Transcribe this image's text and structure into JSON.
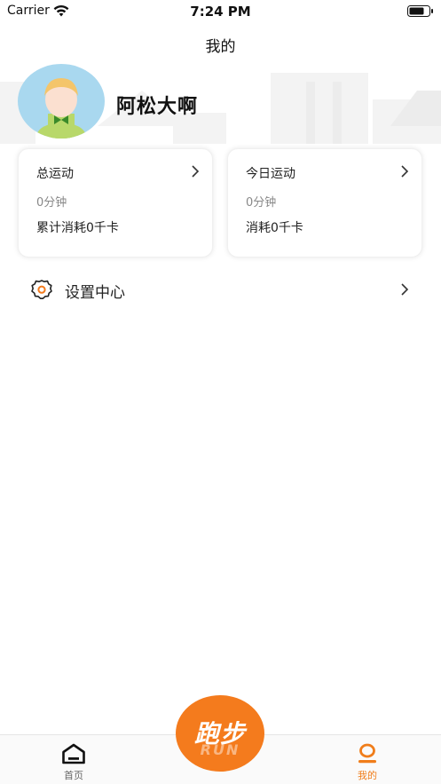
{
  "status_bar": {
    "carrier": "Carrier",
    "time": "7:24 PM"
  },
  "nav": {
    "title": "我的"
  },
  "profile": {
    "username": "阿松大啊"
  },
  "cards": [
    {
      "title": "总运动",
      "duration": "0分钟",
      "calories": "累计消耗0千卡"
    },
    {
      "title": "今日运动",
      "duration": "0分钟",
      "calories": "消耗0千卡"
    }
  ],
  "settings": {
    "label": "设置中心",
    "icon": "gear-icon"
  },
  "tab_bar": {
    "home_label": "首页",
    "mine_label": "我的",
    "run_label": "跑步",
    "run_sub": "RUN"
  },
  "colors": {
    "accent": "#f47b1d",
    "active_tab": "#f07d1a"
  }
}
